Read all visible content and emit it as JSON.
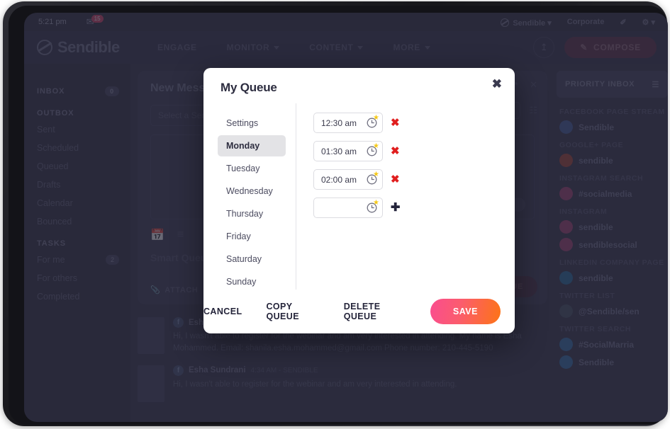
{
  "app": {
    "status_bar": {
      "time": "5:21 pm",
      "mail_icon": "mail-icon",
      "mail_badge": "15"
    },
    "account_strip": {
      "brand": "Sendible",
      "brand_caret": "▾",
      "workspace": "Corporate",
      "wand_icon": "✐",
      "gear_icon": "⚙",
      "gear_caret": "▾"
    },
    "brand_name": "Sendible",
    "nav": [
      {
        "label": "ENGAGE",
        "has_caret": false
      },
      {
        "label": "MONITOR",
        "has_caret": true
      },
      {
        "label": "CONTENT",
        "has_caret": true
      },
      {
        "label": "MORE",
        "has_caret": true
      }
    ],
    "nav_right": {
      "upload_icon": "↥",
      "compose_label": "COMPOSE",
      "compose_icon": "✎"
    },
    "sidebar": {
      "inbox": {
        "label": "INBOX",
        "count": "0"
      },
      "outbox_label": "OUTBOX",
      "outbox_items": [
        "Sent",
        "Scheduled",
        "Queued",
        "Drafts",
        "Calendar",
        "Bounced"
      ],
      "tasks_label": "TASKS",
      "tasks_items": [
        {
          "label": "For me",
          "count": "2"
        },
        {
          "label": "For others",
          "count": ""
        },
        {
          "label": "Completed",
          "count": ""
        }
      ]
    },
    "center_panel": {
      "title": "New Message",
      "service_placeholder": "Select a Service",
      "smart_queue": "Smart Queue",
      "attach_label": "ATTACH",
      "add_queue_label": "ADD TO QUEUE",
      "expand_icon": "↗",
      "close_icon": "✕",
      "remove_icon": "✕",
      "pin_icon": "⚑",
      "grid_icon": "☷",
      "calendar_icon": "31",
      "list_icon": "≡",
      "attach_icon": "📎"
    },
    "right_sidebar": {
      "priority_inbox": "PRIORITY INBOX",
      "menu_icon": "☰",
      "streams": [
        {
          "label": "FACEBOOK PAGE STREAM",
          "name": "Sendible",
          "color": "#3b5998"
        },
        {
          "label": "GOOGLE+ PAGE",
          "name": "sendible",
          "color": "#a33c2b"
        },
        {
          "label": "INSTAGRAM SEARCH",
          "name": "#socialmedia",
          "color": "#a03a6c"
        },
        {
          "label": "INSTAGRAM",
          "name": "sendible",
          "color": "#a03a6c"
        },
        {
          "label": "",
          "name": "sendiblesocial",
          "color": "#a03a6c"
        },
        {
          "label": "LINKEDIN COMPANY PAGE",
          "name": "sendible",
          "color": "#1b6a9c"
        },
        {
          "label": "TWITTER LIST",
          "name": "@Sendible/sen",
          "color": "#3c4a5c"
        },
        {
          "label": "TWITTER SEARCH",
          "name": "#SocialMarria",
          "color": "#2a6ca8"
        },
        {
          "label": "",
          "name": "Sendible",
          "color": "#2a6ca8"
        }
      ]
    },
    "feed": [
      {
        "author": "Esha Sundrani",
        "meta": "4:34 AM - SENDIBLE",
        "body": "Hi, I wasn't able to register for the webinar and am very interested in attending. My name is Esha Mohammed. Email: shanila.esha.mohammed@gmail.com Phone number: 210-445-5190"
      },
      {
        "author": "Esha Sundrani",
        "meta": "4:34 AM - SENDIBLE",
        "body": "Hi, I wasn't able to register for the webinar and am very interested in attending."
      }
    ]
  },
  "modal": {
    "title": "My Queue",
    "close_icon": "✖",
    "days": [
      {
        "label": "Settings",
        "active": false
      },
      {
        "label": "Monday",
        "active": true
      },
      {
        "label": "Tuesday",
        "active": false
      },
      {
        "label": "Wednesday",
        "active": false
      },
      {
        "label": "Thursday",
        "active": false
      },
      {
        "label": "Friday",
        "active": false
      },
      {
        "label": "Saturday",
        "active": false
      },
      {
        "label": "Sunday",
        "active": false
      }
    ],
    "times": [
      {
        "value": "12:30 am",
        "placeholder": "",
        "action": "remove",
        "action_icon": "✖"
      },
      {
        "value": "01:30 am",
        "placeholder": "",
        "action": "remove",
        "action_icon": "✖"
      },
      {
        "value": "02:00 am",
        "placeholder": "",
        "action": "remove",
        "action_icon": "✖"
      },
      {
        "value": "",
        "placeholder": "",
        "action": "add",
        "action_icon": "✚"
      }
    ],
    "clock_icon": "clock-icon",
    "star_glyph": "★",
    "footer": {
      "cancel": "CANCEL",
      "copy_queue": "COPY QUEUE",
      "delete_queue": "DELETE QUEUE",
      "save": "SAVE"
    }
  },
  "colors": {
    "accent_pink": "#fa4d8f",
    "accent_orange": "#fd7415",
    "delete_red": "#e01e1e",
    "star_yellow": "#f5c816",
    "app_bg": "#2b2b3d"
  }
}
